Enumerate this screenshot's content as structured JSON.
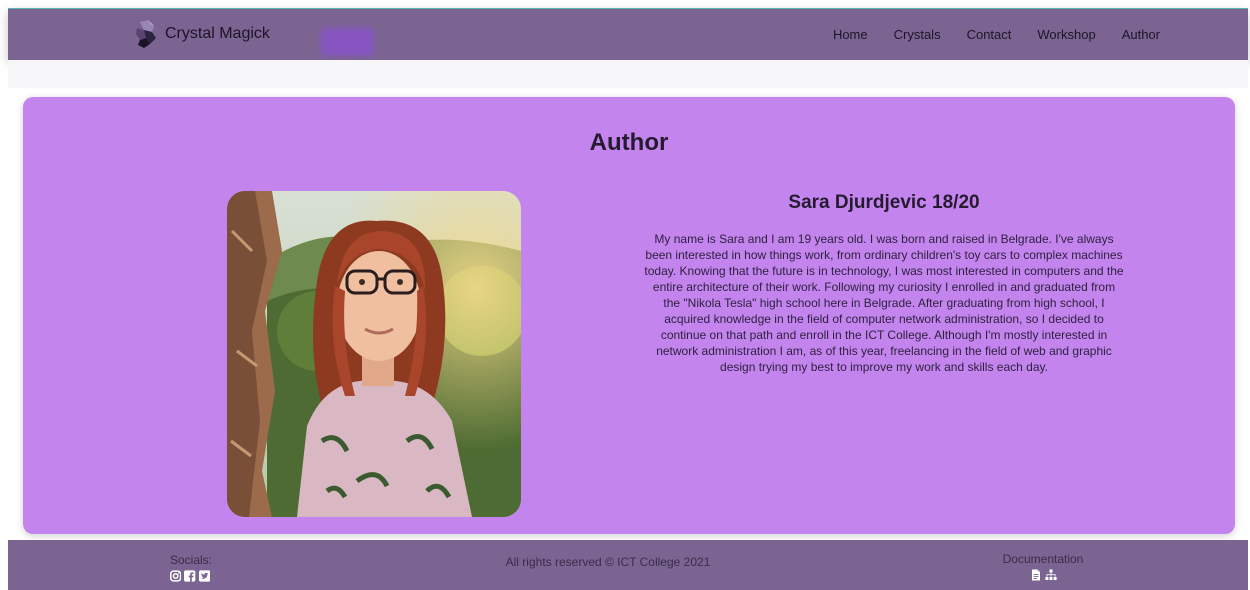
{
  "colors": {
    "navbar_bg": "#7b6491",
    "card_bg": "#c384ee",
    "footer_bg": "#7b6491",
    "text_dark": "#241b30"
  },
  "navbar": {
    "brand": "Crystal Magick",
    "logo_icon": "crystal-icon",
    "links": [
      "Home",
      "Crystals",
      "Contact",
      "Workshop",
      "Author"
    ]
  },
  "main": {
    "title": "Author",
    "author_name": "Sara Djurdjevic 18/20",
    "bio": "My name is Sara and I am 19 years old. I was born and raised in Belgrade. I've always been interested in how things work, from ordinary children's toy cars to complex machines today. Knowing that the future is in technology, I was most interested in computers and the entire architecture of their work. Following my curiosity I enrolled in and graduated from the \"Nikola Tesla\" high school here in Belgrade. After graduating from high school, I acquired knowledge in the field of computer network administration, so I decided to continue on that path and enroll in the ICT College. Although I'm mostly interested in network administration I am, as of this year, freelancing in the field of web and graphic design trying my best to improve my work and skills each day."
  },
  "footer": {
    "socials_label": "Socials:",
    "social_icons": [
      "instagram-icon",
      "facebook-icon",
      "twitter-icon"
    ],
    "copyright": "All rights reserved © ICT College 2021",
    "docs_label": "Documentation",
    "doc_icons": [
      "document-icon",
      "sitemap-icon"
    ]
  }
}
